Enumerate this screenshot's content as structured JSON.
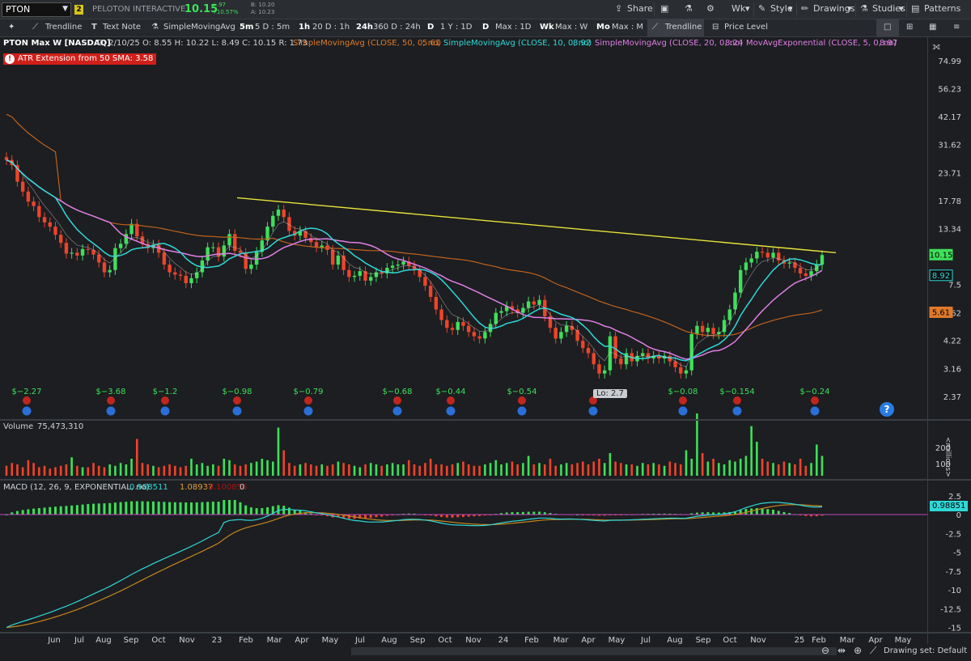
{
  "header": {
    "symbol": "PTON",
    "link_badge": "2",
    "company": "PELOTON INTERACTIVE",
    "last": "10.15",
    "change": "+.97",
    "change_pct": "+10.57%",
    "bid": "B: 10.20",
    "ask": "A: 10.23",
    "buttons": {
      "share": "Share",
      "wk": "Wk",
      "style": "Style",
      "drawings": "Drawings",
      "studies": "Studies",
      "patterns": "Patterns"
    }
  },
  "toolbar": {
    "trendline": "Trendline",
    "textnote": "Text Note",
    "sma": "SimpleMovingAvg",
    "presets": [
      {
        "key": "5m",
        "label": "5 D : 5m"
      },
      {
        "key": "1h",
        "label": "20 D : 1h"
      },
      {
        "key": "24h",
        "label": "360 D : 24h"
      },
      {
        "key": "D",
        "label": "1 Y : 1D"
      },
      {
        "key": "D",
        "label": "Max : 1D"
      },
      {
        "key": "Wk",
        "label": "Max : W"
      },
      {
        "key": "Mo",
        "label": "Max : M"
      }
    ],
    "trendline2": "Trendline",
    "price_level": "Price Level"
  },
  "legend": {
    "title": "PTON Max W [NASDAQ]",
    "ohlc": "D: 2/10/25   O: 8.55   H: 10.22   L: 8.49   C: 10.15   R: 1.73",
    "sma50": "SimpleMovingAvg (CLOSE, 50, 0, no)",
    "sma50_val": "5.61",
    "sma10": "SimpleMovingAvg (CLOSE, 10, 0, no)",
    "sma10_val": "8.92",
    "sma20": "SimpleMovingAvg (CLOSE, 20, 0, no)",
    "sma20_val": "8.24",
    "ema5": "MovAvgExponential (CLOSE, 5, 0, no)",
    "ema5_val": "8.97"
  },
  "atr_label": "ATR Extension from 50 SMA: 3.58",
  "low_label": "Lo: 2.7",
  "help": "?",
  "volume_label": "Volume",
  "volume_value": "75,473,310",
  "macd_label": "MACD (12, 26, 9, EXPONENTIAL, no)",
  "macd_values": [
    "0.988511",
    "1.08937",
    "-0.100856",
    "0"
  ],
  "macd_axis_box": "0.98851",
  "vol_unit": "<millions>",
  "drawing_set": "Drawing set: Default",
  "colors": {
    "up": "#3ee05a",
    "down": "#f0432a",
    "sma10": "#2fd8d8",
    "sma20": "#e07ee6",
    "sma50": "#c0621c",
    "trend": "#e8e23a",
    "macd": "#2fd8d8",
    "signal": "#c8861c"
  },
  "chart_data": [
    {
      "type": "candlestick",
      "title": "PTON Max W [NASDAQ]",
      "yscale": "log",
      "ylim": [
        2.0,
        95
      ],
      "y_ticks": [
        "74.99",
        "56.23",
        "42.17",
        "31.62",
        "23.71",
        "17.78",
        "13.34",
        "10.0",
        "7.5",
        "5.62",
        "4.22",
        "3.16",
        "2.37"
      ],
      "x_ticks": [
        "Jun",
        "Jul",
        "Aug",
        "Sep",
        "Oct",
        "Nov",
        "23",
        "Feb",
        "Mar",
        "Apr",
        "May",
        "Jun",
        "Jul",
        "Aug",
        "Sep",
        "Oct",
        "Nov",
        "24",
        "Feb",
        "Mar",
        "Apr",
        "May",
        "Jun",
        "Jul",
        "Aug",
        "Sep",
        "Oct",
        "Nov",
        "25",
        "Feb",
        "Mar",
        "Apr",
        "May"
      ],
      "close": [
        27,
        25.6,
        21.6,
        19.5,
        17.6,
        16.8,
        15,
        14.2,
        13.6,
        12.5,
        11.5,
        10.3,
        10.4,
        10.1,
        10.8,
        10.7,
        10.2,
        9.4,
        8.5,
        8.7,
        10.9,
        11.4,
        12.6,
        14,
        12.3,
        11.4,
        10.9,
        11.3,
        10.4,
        9.2,
        8.5,
        8.3,
        8.2,
        7.6,
        8,
        8.5,
        9.6,
        11,
        11,
        10,
        11.2,
        12.6,
        10.6,
        10.4,
        8.8,
        9.2,
        10.5,
        11.8,
        13.6,
        15.2,
        16.2,
        15,
        13,
        12.4,
        13,
        12.1,
        11.6,
        11,
        11.2,
        10.7,
        9.2,
        10.1,
        8.7,
        8.1,
        8.2,
        8.6,
        7.8,
        8.1,
        8.5,
        8.4,
        8.9,
        9.1,
        9.2,
        9.5,
        9.1,
        8.7,
        8.1,
        7.4,
        6.6,
        5.8,
        5.2,
        4.8,
        4.7,
        5.1,
        4.9,
        4.6,
        4.4,
        4.3,
        4.6,
        5,
        5.6,
        5.7,
        6,
        5.8,
        5.6,
        5.9,
        6.3,
        6.1,
        6.4,
        5.4,
        4.8,
        4.3,
        4.6,
        4.9,
        4.7,
        4.2,
        3.9,
        3.7,
        3.3,
        3,
        3.1,
        4.4,
        3.5,
        3.3,
        3.7,
        3.4,
        3.6,
        3.7,
        3.5,
        3.6,
        3.5,
        3.6,
        3.4,
        3.2,
        3,
        3.1,
        4.5,
        4.9,
        4.6,
        4.8,
        4.5,
        4.6,
        5.2,
        5.8,
        6.9,
        8.7,
        9.4,
        9.8,
        10.5,
        10.4,
        9.9,
        10.4,
        9.6,
        9.3,
        9.4,
        8.9,
        8.4,
        8.2,
        8.6,
        9.2,
        10.15
      ],
      "series": [
        {
          "name": "SimpleMovingAvg (CLOSE, 50, 0, no)",
          "last": 5.61
        },
        {
          "name": "SimpleMovingAvg (CLOSE, 10, 0, no)",
          "last": 8.92
        },
        {
          "name": "SimpleMovingAvg (CLOSE, 20, 0, no)",
          "last": 8.24
        },
        {
          "name": "MovAvgExponential (CLOSE, 5, 0, no)",
          "last": 8.97
        }
      ],
      "earnings": [
        "$−2.27",
        "$−3.68",
        "$−1.2",
        "$−0.98",
        "$−0.79",
        "$−0.68",
        "$−0.44",
        "$−0.54",
        "",
        "$−0.08",
        "$−0.154",
        "$−0.24"
      ],
      "trendline": {
        "from": 18.3,
        "to": 10.4
      },
      "last_labels": [
        "10.15",
        "8.92",
        "5.61"
      ]
    },
    {
      "type": "bar",
      "title": "Volume",
      "y_ticks": [
        "200",
        "100"
      ],
      "unit": "<millions>",
      "values": [
        35,
        45,
        40,
        30,
        55,
        45,
        30,
        35,
        25,
        30,
        35,
        40,
        65,
        35,
        30,
        30,
        45,
        35,
        30,
        40,
        35,
        45,
        40,
        60,
        130,
        45,
        40,
        35,
        30,
        35,
        40,
        35,
        30,
        35,
        60,
        40,
        45,
        35,
        40,
        35,
        60,
        55,
        40,
        35,
        40,
        45,
        50,
        60,
        55,
        50,
        170,
        90,
        45,
        35,
        40,
        45,
        40,
        35,
        40,
        35,
        40,
        50,
        45,
        40,
        35,
        30,
        40,
        45,
        40,
        35,
        40,
        45,
        40,
        40,
        55,
        40,
        35,
        45,
        60,
        40,
        40,
        35,
        40,
        45,
        50,
        40,
        35,
        35,
        40,
        45,
        55,
        40,
        45,
        50,
        40,
        45,
        70,
        40,
        45,
        40,
        60,
        35,
        40,
        45,
        40,
        45,
        50,
        40,
        50,
        60,
        45,
        80,
        50,
        45,
        40,
        40,
        35,
        45,
        40,
        45,
        40,
        35,
        50,
        45,
        40,
        90,
        60,
        220,
        80,
        50,
        60,
        45,
        40,
        55,
        50,
        60,
        70,
        175,
        120,
        60,
        50,
        45,
        40,
        50,
        45,
        40,
        60,
        35,
        45,
        110,
        70
      ]
    },
    {
      "type": "line",
      "title": "MACD (12, 26, 9, EXPONENTIAL, no)",
      "y_ticks": [
        "2.5",
        "0",
        "-2.5",
        "-5",
        "-7.5",
        "-10",
        "-12.5",
        "-15"
      ],
      "series": [
        {
          "name": "MACD",
          "last": 0.988511
        },
        {
          "name": "Signal",
          "last": 1.08937
        },
        {
          "name": "Diff",
          "last": -0.100856
        }
      ]
    }
  ]
}
